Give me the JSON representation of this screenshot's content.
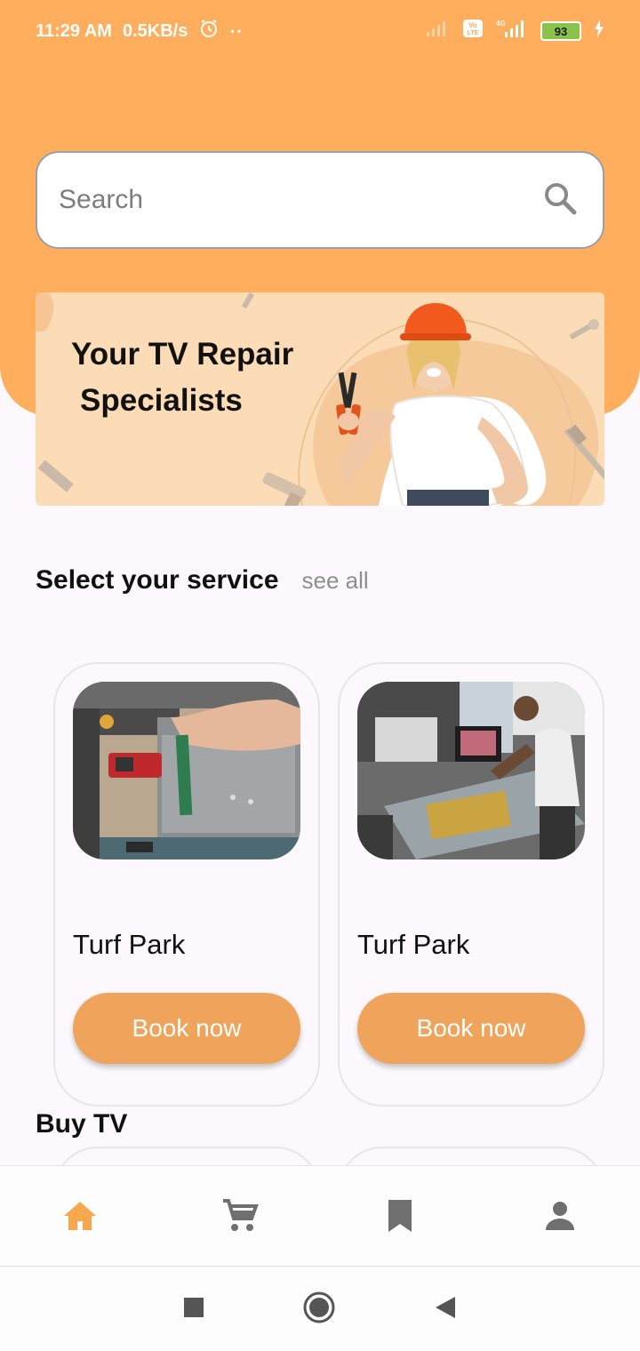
{
  "status_bar": {
    "time": "11:29 AM",
    "net_speed": "0.5KB/s",
    "dots": "• •",
    "battery": "93",
    "icons": [
      "alarm-icon",
      "signal-icon",
      "volte-icon",
      "4g-signal-icon",
      "battery-icon",
      "charging-icon"
    ]
  },
  "search": {
    "placeholder": "Search",
    "icon": "search-icon"
  },
  "banner": {
    "title_line1": "Your TV Repair",
    "title_line2": "Specialists"
  },
  "services": {
    "title": "Select your service",
    "see_all": "see all",
    "cards": [
      {
        "name": "Turf Park",
        "button": "Book now"
      },
      {
        "name": "Turf Park",
        "button": "Book now"
      }
    ]
  },
  "buy_tv": {
    "title": "Buy TV"
  },
  "bottom_nav": {
    "items": [
      "home-icon",
      "cart-icon",
      "bookmark-icon",
      "profile-icon"
    ],
    "active": "home-icon"
  },
  "colors": {
    "accent": "#feae5c",
    "button": "#f0a35a",
    "inactive_icon": "#6f6f6f"
  }
}
